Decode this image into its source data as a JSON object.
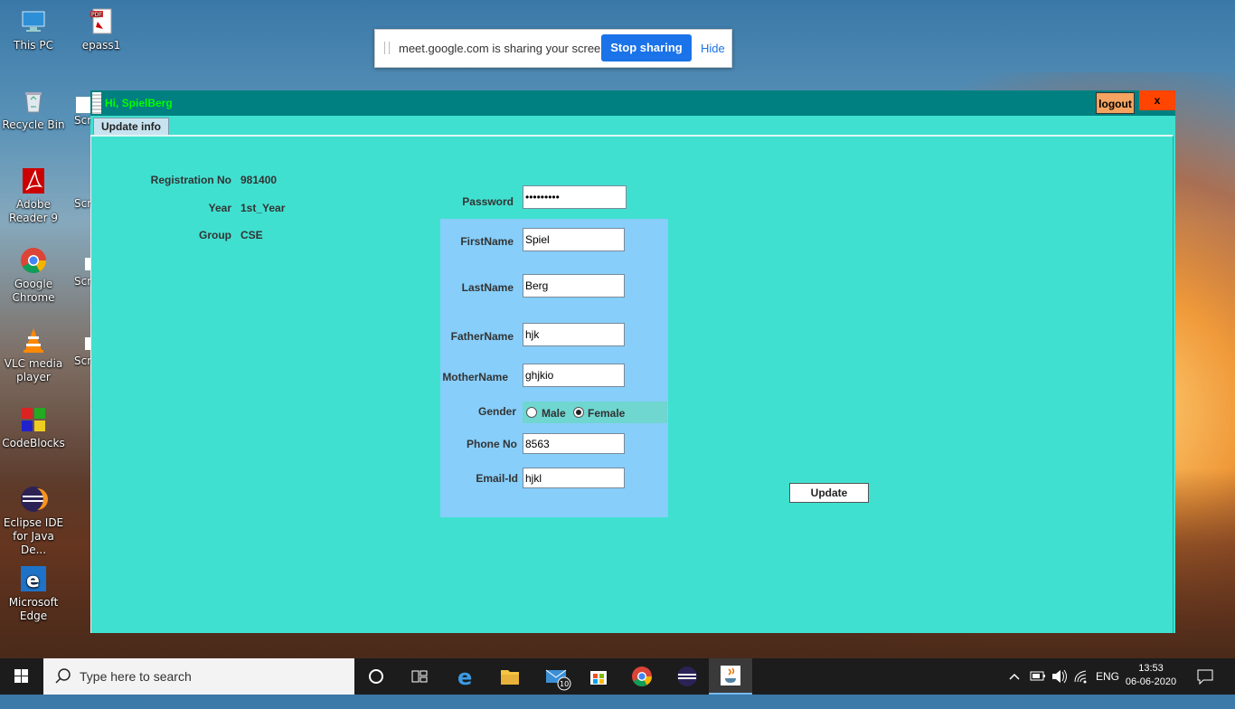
{
  "desktop": {
    "icons": [
      {
        "label": "This PC"
      },
      {
        "label": "epass1"
      },
      {
        "label": "Recycle Bin"
      },
      {
        "label": "Adobe Reader 9"
      },
      {
        "label": "Google Chrome"
      },
      {
        "label": "VLC media player"
      },
      {
        "label": "CodeBlocks"
      },
      {
        "label": "Eclipse IDE for Java De..."
      },
      {
        "label": "Microsoft Edge"
      }
    ],
    "partial_label": "Scr"
  },
  "share_bar": {
    "message": "meet.google.com is sharing your screen.",
    "stop_label": "Stop sharing",
    "hide_label": "Hide"
  },
  "app": {
    "greeting": "Hi, SpielBerg",
    "logout_label": "logout",
    "close_label": "x",
    "tab_label": "Update info",
    "info": {
      "reg_label": "Registration No",
      "reg_value": "981400",
      "year_label": "Year",
      "year_value": "1st_Year",
      "group_label": "Group",
      "group_value": "CSE"
    },
    "form": {
      "password_label": "Password",
      "password_value": "•••••••••",
      "firstname_label": "FirstName",
      "firstname_value": "Spiel",
      "lastname_label": "LastName",
      "lastname_value": "Berg",
      "fathername_label": "FatherName",
      "fathername_value": "hjk",
      "mothername_label": "MotherName",
      "mothername_value": "ghjkio",
      "gender_label": "Gender",
      "gender_male": "Male",
      "gender_female": "Female",
      "gender_selected": "Female",
      "phone_label": "Phone No",
      "phone_value": "8563",
      "email_label": "Email-Id",
      "email_value": "hjkl"
    },
    "update_label": "Update"
  },
  "taskbar": {
    "search_placeholder": "Type here to search",
    "mail_badge": "10",
    "language": "ENG",
    "time": "13:53",
    "date": "06-06-2020"
  }
}
